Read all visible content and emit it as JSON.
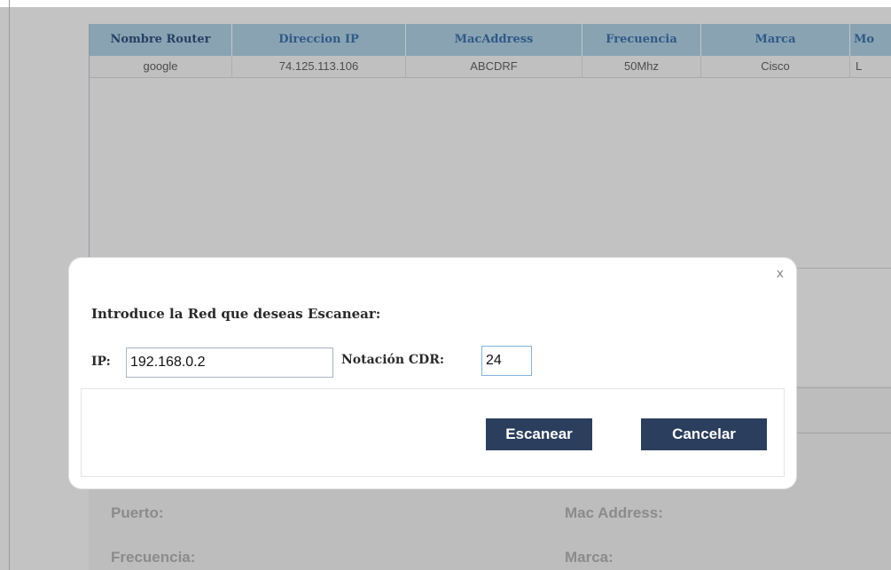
{
  "table": {
    "headers": [
      "Nombre Router",
      "Direccion IP",
      "MacAddress",
      "Frecuencia",
      "Marca",
      "Mo"
    ],
    "rows": [
      [
        "google",
        "74.125.113.106",
        "ABCDRF",
        "50Mhz",
        "Cisco",
        "L"
      ]
    ]
  },
  "form": {
    "puerto_label": "Puerto:",
    "frecuencia_label": "Frecuencia:",
    "mac_label": "Mac Address:",
    "marca_label": "Marca:"
  },
  "modal": {
    "close_label": "x",
    "prompt": "Introduce la Red que deseas Escanear:",
    "ip_label": "IP:",
    "ip_value": "192.168.0.2",
    "cdr_label": "Notación CDR:",
    "cdr_value": "24",
    "scan_button": "Escanear",
    "cancel_button": "Cancelar"
  },
  "colors": {
    "header_bg": "#8aa3b3",
    "header_text": "#2f5a87",
    "button_bg": "#2c3e5d"
  }
}
